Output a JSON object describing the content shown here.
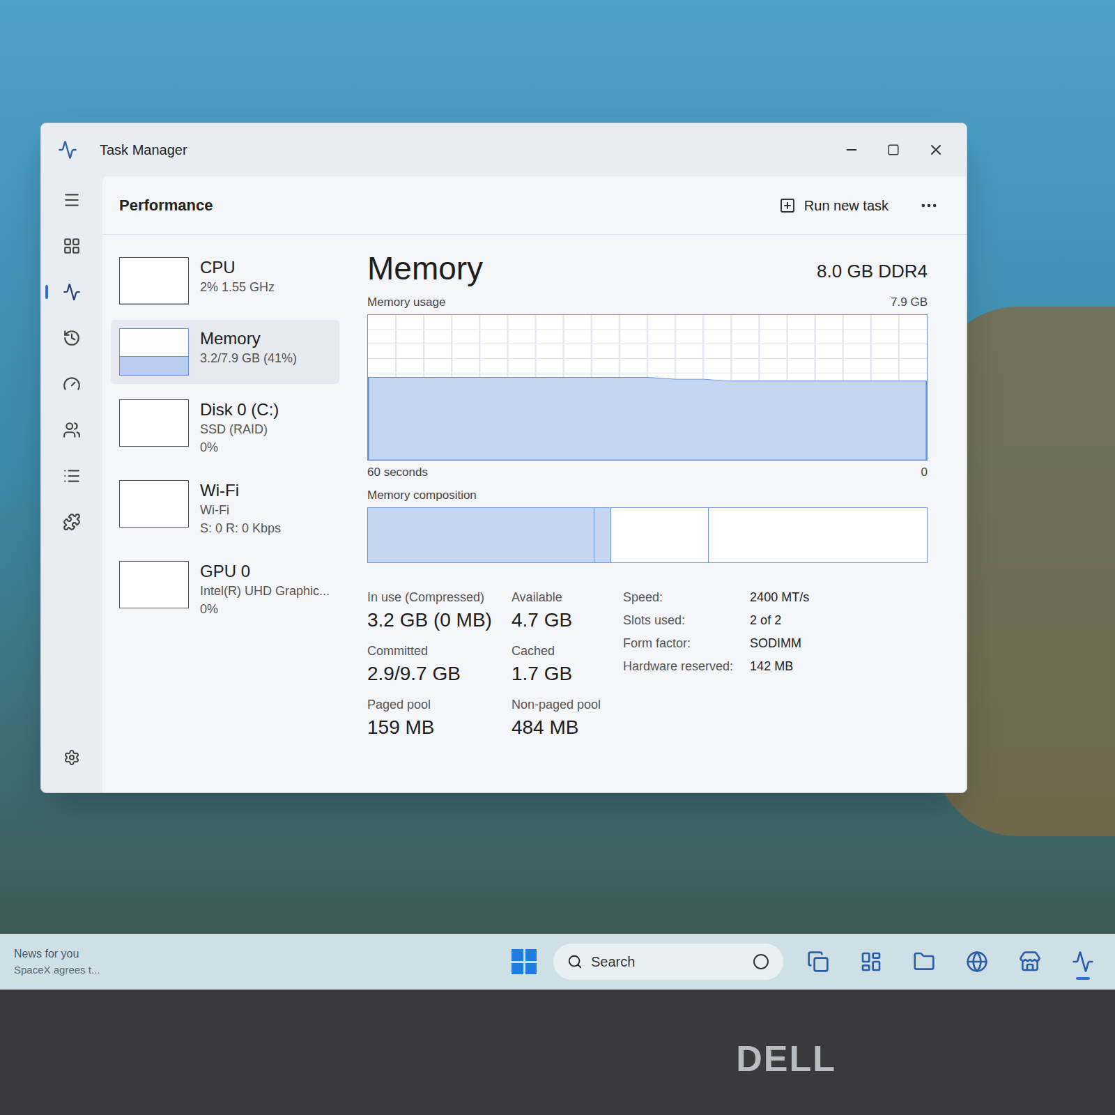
{
  "window": {
    "title": "Task Manager"
  },
  "nav_rail": {
    "items": [
      {
        "selected": false
      },
      {
        "selected": false
      },
      {
        "selected": true
      },
      {
        "selected": false
      },
      {
        "selected": false
      },
      {
        "selected": false
      },
      {
        "selected": false
      },
      {
        "selected": false
      }
    ],
    "settings": {
      "selected": false
    }
  },
  "header": {
    "title": "Performance",
    "run_new_task": "Run new task"
  },
  "devices": [
    {
      "name": "CPU",
      "lines": [
        "2% 1.55 GHz"
      ],
      "selected": false,
      "level": 0.02
    },
    {
      "name": "Memory",
      "lines": [
        "3.2/7.9 GB (41%)"
      ],
      "selected": true,
      "level": 0.41
    },
    {
      "name": "Disk 0 (C:)",
      "lines": [
        "SSD (RAID)",
        "0%"
      ],
      "selected": false,
      "level": 0
    },
    {
      "name": "Wi-Fi",
      "lines": [
        "Wi-Fi",
        "S: 0 R: 0 Kbps"
      ],
      "selected": false,
      "level": 0
    },
    {
      "name": "GPU 0",
      "lines": [
        "Intel(R) UHD Graphic...",
        "0%"
      ],
      "selected": false,
      "level": 0
    }
  ],
  "memory": {
    "title": "Memory",
    "capacity": "8.0 GB DDR4",
    "usage_label": "Memory usage",
    "max_label": "7.9 GB",
    "max_value": 7.9,
    "time_label": "60 seconds",
    "zero_label": "0",
    "usage_history": [
      4.5,
      4.5,
      4.5,
      4.5,
      4.5,
      4.5,
      4.5,
      4.5,
      4.5,
      4.5,
      4.5,
      4.4,
      4.4,
      4.3,
      4.3,
      4.3,
      4.3,
      4.3,
      4.3,
      4.3,
      4.3
    ],
    "composition_label": "Memory composition",
    "composition": [
      {
        "level": 0.405,
        "filled": true
      },
      {
        "level": 0.03,
        "filled": true
      },
      {
        "level": 0.175,
        "filled": false
      },
      {
        "level": 0.39,
        "filled": false
      }
    ],
    "stats": [
      {
        "label": "In use (Compressed)",
        "value": "3.2 GB (0 MB)"
      },
      {
        "label": "Available",
        "value": "4.7 GB"
      },
      {
        "label": "Committed",
        "value": "2.9/9.7 GB"
      },
      {
        "label": "Cached",
        "value": "1.7 GB"
      },
      {
        "label": "Paged pool",
        "value": "159 MB"
      },
      {
        "label": "Non-paged pool",
        "value": "484 MB"
      }
    ],
    "specs": [
      {
        "label": "Speed:",
        "value": "2400 MT/s"
      },
      {
        "label": "Slots used:",
        "value": "2 of 2"
      },
      {
        "label": "Form factor:",
        "value": "SODIMM"
      },
      {
        "label": "Hardware reserved:",
        "value": "142 MB"
      }
    ]
  },
  "taskbar": {
    "news": {
      "title": "News for you",
      "headline": "SpaceX agrees t..."
    },
    "search": {
      "placeholder": "Search"
    },
    "apps": [
      {
        "active": false
      },
      {
        "active": false
      },
      {
        "active": false
      },
      {
        "active": false
      },
      {
        "active": false
      },
      {
        "active": true
      }
    ]
  },
  "bezel": {
    "logo": "DELL"
  }
}
